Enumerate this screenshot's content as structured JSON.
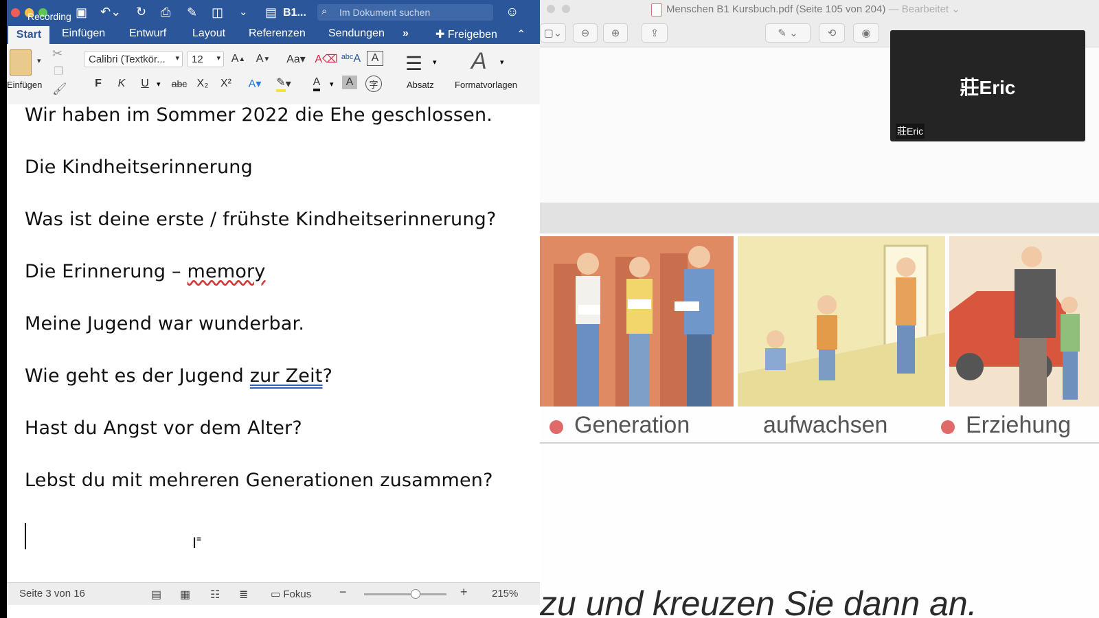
{
  "pdf": {
    "title": "Menschen B1 Kursbuch.pdf (Seite 105 von 204)",
    "separator": "—",
    "status": "Bearbeitet",
    "labels": [
      "Generation",
      "aufwachsen",
      "Erziehung"
    ],
    "bottom_text": "zu und kreuzen Sie dann an."
  },
  "zoom": {
    "name_big": "莊Eric",
    "name_small": "莊Eric"
  },
  "word": {
    "recording": "Recording",
    "doc_name": "B1...",
    "search_placeholder": "Im Dokument suchen",
    "tabs": [
      "Start",
      "Einfügen",
      "Entwurf",
      "Layout",
      "Referenzen",
      "Sendungen"
    ],
    "more": "»",
    "share": "Freigeben",
    "font_name": "Calibri (Textkör...",
    "font_size": "12",
    "paste_label": "Einfügen",
    "paragraph_label": "Absatz",
    "styles_label": "Formatvorlagen",
    "format_buttons": {
      "bold": "F",
      "italic": "K",
      "underline": "U",
      "strike": "abc",
      "sub": "X₂",
      "sup": "X²"
    },
    "paragraphs": [
      {
        "text": "Wir haben im Sommer 2022 die Ehe geschlossen."
      },
      {
        "text": "Die Kindheitserinnerung"
      },
      {
        "text": "Was ist deine erste / frühste Kindheitserinnerung?"
      },
      {
        "before": "Die Erinnerung – ",
        "marked": "memory",
        "after": ""
      },
      {
        "text": "Meine Jugend war wunderbar."
      },
      {
        "before": "Wie geht es der Jugend ",
        "marked": "zur Zeit",
        "after": "?"
      },
      {
        "text": "Hast du Angst vor dem Alter?"
      },
      {
        "text": "Lebst du mit mehreren Generationen zusammen?"
      }
    ],
    "status": {
      "page": "Seite 3 von 16",
      "focus": "Fokus",
      "zoom": "215%"
    }
  }
}
